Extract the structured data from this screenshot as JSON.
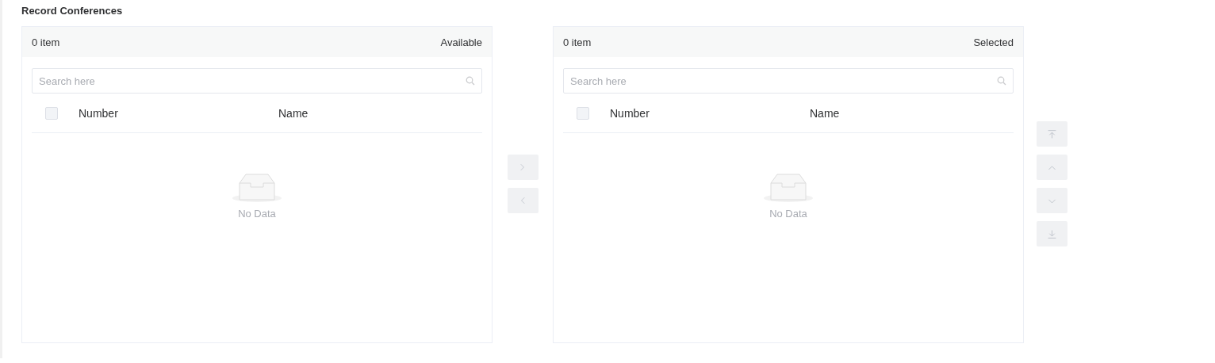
{
  "title": "Record Conferences",
  "panels": [
    {
      "count": "0 item",
      "caption": "Available",
      "search": {
        "placeholder": "Search here"
      },
      "select_all": {
        "checked": false
      },
      "columns": [
        "Number",
        "Name"
      ],
      "empty_text": "No Data"
    },
    {
      "count": "0 item",
      "caption": "Selected",
      "search": {
        "placeholder": "Search here"
      },
      "select_all": {
        "checked": false
      },
      "columns": [
        "Number",
        "Name"
      ],
      "empty_text": "No Data"
    }
  ],
  "transfer_buttons": [
    {
      "kind": "right",
      "disabled": true
    },
    {
      "kind": "left",
      "disabled": true
    }
  ],
  "order_buttons": [
    {
      "kind": "top",
      "disabled": true
    },
    {
      "kind": "up",
      "disabled": true
    },
    {
      "kind": "down",
      "disabled": true
    },
    {
      "kind": "bottom",
      "disabled": true
    }
  ]
}
